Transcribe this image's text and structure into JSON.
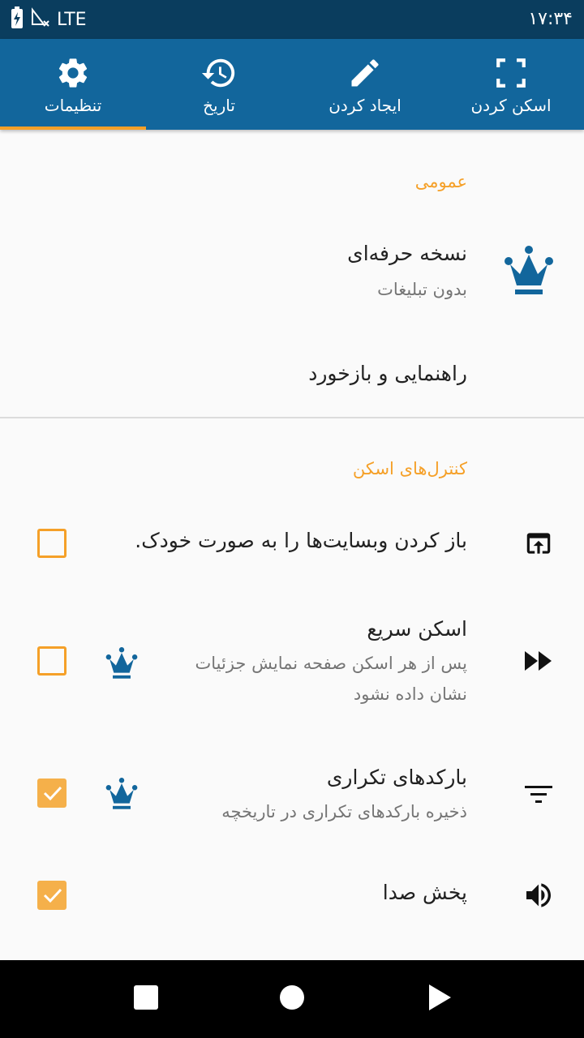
{
  "status_bar": {
    "network": "LTE",
    "time": "۱۷:۳۴"
  },
  "tabs": [
    {
      "label": "تنظیمات",
      "icon": "gear-icon",
      "active": true
    },
    {
      "label": "تاریخ",
      "icon": "history-icon",
      "active": false
    },
    {
      "label": "ایجاد کردن",
      "icon": "pencil-icon",
      "active": false
    },
    {
      "label": "اسکن کردن",
      "icon": "scan-frame-icon",
      "active": false
    }
  ],
  "general": {
    "header": "عمومی",
    "pro": {
      "title": "نسخه حرفه‌ای",
      "summary": "بدون تبلیغات",
      "icon": "crown-icon"
    },
    "help": {
      "title": "راهنمایی و بازخورد"
    }
  },
  "scan_controls": {
    "header": "کنترل‌های اسکن",
    "open_websites": {
      "title": "باز کردن وبسایت‌ها را به صورت خودک.",
      "icon": "open-in-browser-icon",
      "checked": false
    },
    "quick_scan": {
      "title": "اسکن سریع",
      "summary_line1": "پس از هر اسکن صفحه نمایش جزئیات",
      "summary_line2": "نشان داده نشود",
      "icon": "fast-forward-icon",
      "checked": false,
      "premium_icon": "crown-icon"
    },
    "duplicate_barcodes": {
      "title": "بارکدهای تکراری",
      "summary": "ذخیره بارکدهای تکراری در تاریخچه",
      "icon": "filter-icon",
      "checked": true,
      "premium_icon": "crown-icon"
    },
    "sound": {
      "title": "پخش صدا",
      "icon": "volume-icon",
      "checked": true
    }
  },
  "colors": {
    "status_bar": "#0a3d5e",
    "tab_bar": "#12669c",
    "accent": "#f5a028",
    "crown": "#12669c"
  },
  "nav_bar": {
    "buttons": [
      "recents-square-icon",
      "home-circle-icon",
      "back-triangle-icon"
    ]
  }
}
